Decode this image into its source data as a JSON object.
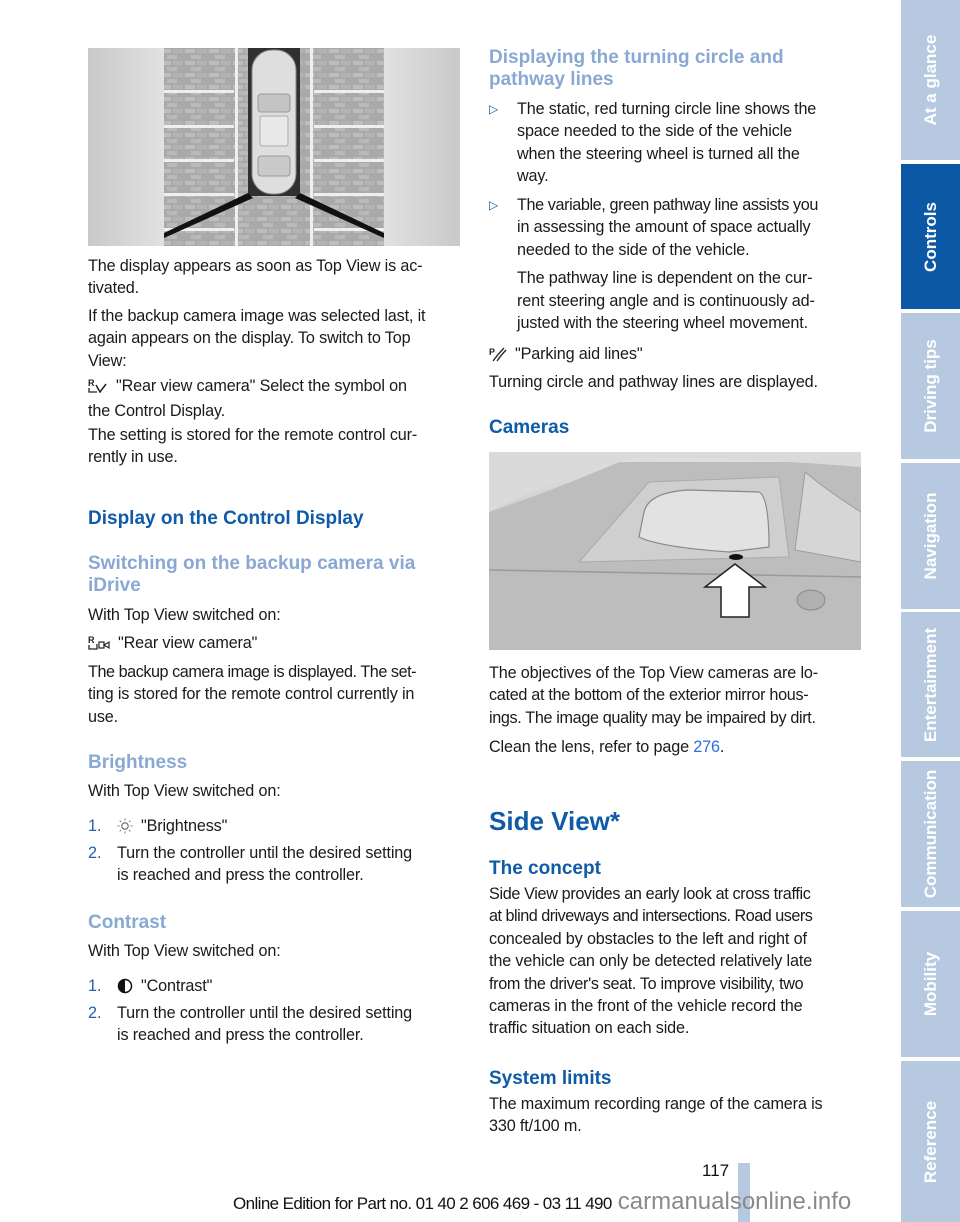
{
  "left_column": {
    "figure_topview_alt": "Top View display: vehicle from above between parking areas with red turning circle lines",
    "para1": "The display appears as soon as Top View is ac-tivated.",
    "para1_lines": [
      "The display appears as soon as Top View is ac-",
      "tivated."
    ],
    "para2_lines": [
      "If the backup camera image was selected last, it",
      "again appears on the display. To switch to Top",
      "View:"
    ],
    "rear_cam_select_lines": [
      "\"Rear view camera\" Select the symbol on",
      "the Control Display."
    ],
    "para3_lines": [
      "The setting is stored for the remote control cur-",
      "rently in use."
    ],
    "heading_display": "Display on the Control Display",
    "heading_switching_lines": [
      "Switching on the backup camera via",
      "iDrive"
    ],
    "with_top_view_1": "With Top View switched on:",
    "rear_cam_label": "\"Rear view camera\"",
    "para4_lines": [
      "The backup camera image is displayed. The set-",
      "ting is stored for the remote control currently in",
      "use."
    ],
    "heading_brightness": "Brightness",
    "with_top_view_2": "With Top View switched on:",
    "brightness_steps": [
      {
        "num": "1.",
        "icon": "sun-icon",
        "text": "\"Brightness\""
      },
      {
        "num": "2.",
        "lines": [
          "Turn the controller until the desired setting",
          "is reached and press the controller."
        ]
      }
    ],
    "heading_contrast": "Contrast",
    "with_top_view_3": "With Top View switched on:",
    "contrast_steps": [
      {
        "num": "1.",
        "icon": "contrast-icon",
        "text": "\"Contrast\""
      },
      {
        "num": "2.",
        "lines": [
          "Turn the controller until the desired setting",
          "is reached and press the controller."
        ]
      }
    ]
  },
  "right_column": {
    "heading_turning_lines": [
      "Displaying the turning circle and",
      "pathway lines"
    ],
    "bullets": [
      {
        "lines": [
          "The static, red turning circle line shows the",
          "space needed to the side of the vehicle",
          "when the steering wheel is turned all the",
          "way."
        ]
      },
      {
        "lines": [
          "The variable, green pathway line assists you",
          "in assessing the amount of space actually",
          "needed to the side of the vehicle."
        ],
        "extra_lines": [
          "The pathway line is dependent on the cur-",
          "rent steering angle and is continuously ad-",
          "justed with the steering wheel movement."
        ]
      }
    ],
    "parking_aid_label": "\"Parking aid lines\"",
    "parking_aid_desc": "Turning circle and pathway lines are displayed.",
    "heading_cameras": "Cameras",
    "figure_camera_alt": "Exterior mirror with camera lens at bottom, indicated by arrow",
    "para_cameras_lines": [
      "The objectives of the Top View cameras are lo-",
      "cated at the bottom of the exterior mirror hous-",
      "ings. The image quality may be impaired by dirt."
    ],
    "clean_lens_prefix": "Clean the lens, refer to page ",
    "clean_lens_page": "276",
    "clean_lens_suffix": ".",
    "heading_side_view": "Side View*",
    "heading_concept": "The concept",
    "para_concept_lines": [
      "Side View provides an early look at cross traffic",
      "at blind driveways and intersections. Road users",
      "concealed by obstacles to the left and right of",
      "the vehicle can only be detected relatively late",
      "from the driver's seat. To improve visibility, two",
      "cameras in the front of the vehicle record the",
      "traffic situation on each side."
    ],
    "heading_limits": "System limits",
    "para_limits_lines": [
      "The maximum recording range of the camera is",
      "330 ft/100 m."
    ]
  },
  "side_tabs": [
    {
      "label": "At a glance",
      "active": false
    },
    {
      "label": "Controls",
      "active": true
    },
    {
      "label": "Driving tips",
      "active": false
    },
    {
      "label": "Navigation",
      "active": false
    },
    {
      "label": "Entertainment",
      "active": false
    },
    {
      "label": "Communication",
      "active": false
    },
    {
      "label": "Mobility",
      "active": false
    },
    {
      "label": "Reference",
      "active": false
    }
  ],
  "footer": {
    "page_number": "117",
    "edition": "Online Edition for Part no. 01 40 2 606 469 - 03 11 490",
    "watermark": "carmanualsonline.info"
  },
  "colors": {
    "heading_blue": "#0f5ba7",
    "subheading_blue": "#89a8d3",
    "tab_inactive": "#b7c8e1",
    "tab_active": "#0d58a4",
    "link_blue": "#2a6ee6"
  }
}
